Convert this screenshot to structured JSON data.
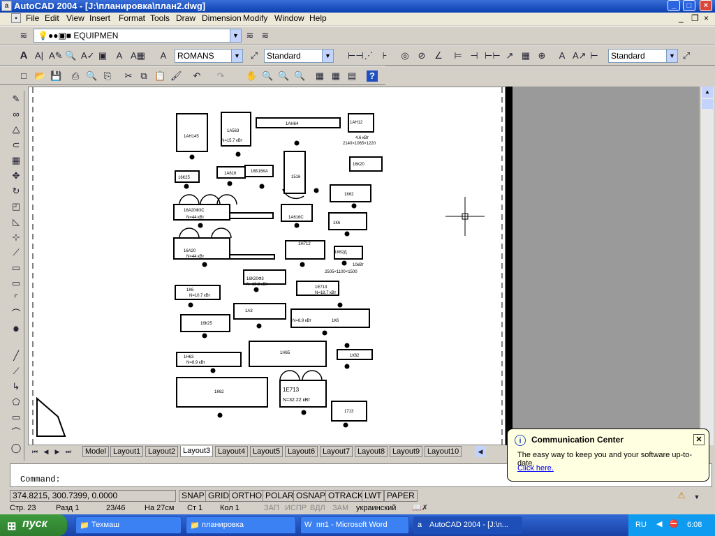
{
  "window": {
    "title": "AutoCAD 2004 - [J:\\планировка\\план2.dwg]"
  },
  "menu": [
    "File",
    "Edit",
    "View",
    "Insert",
    "Format",
    "Tools",
    "Draw",
    "Dimension",
    "Modify",
    "Window",
    "Help"
  ],
  "layer_combo": {
    "value": "EQUIPMEN"
  },
  "text_style": {
    "value": "ROMANS"
  },
  "dim_style": {
    "value": "Standard"
  },
  "table_style": {
    "value": "Standard"
  },
  "drawing_labels": [
    "1АН145",
    "1А563",
    "1АН64",
    "1АН12",
    "1А616",
    "16Б16",
    "1516",
    "16К20",
    "1К62",
    "16А20Ф3С",
    "1А616С",
    "1К62б",
    "16А20",
    "1Н712",
    "1Н713",
    "1А3",
    "16К25",
    "1Н65",
    "1Е713",
    "1713",
    "1А916",
    "16К20Ф3",
    "16Б16КА",
    "1К6",
    "1Е713",
    "1К62Д",
    "1Н63",
    "1К62",
    "1К62"
  ],
  "drawing_power": {
    "p1": "N=15.7 кВт",
    "p2": "N=44 кВт",
    "p3": "N=44 кВт",
    "p4": "N=10.8 кВт",
    "p5": "N=8.9 кВт",
    "p6": "N=32.22 кВт",
    "p7": "N=18.7 кВт",
    "p8": "N=10.7 кВт",
    "p9": "N=8.9 кВт",
    "p10": "N=32.22 кВт",
    "p11": "10кВт",
    "p12": "2505×1100×1500",
    "p13": "4.6 кВт",
    "p14": "2140×1065×1220"
  },
  "tabs": [
    "Model",
    "Layout1",
    "Layout2",
    "Layout3",
    "Layout4",
    "Layout5",
    "Layout6",
    "Layout7",
    "Layout8",
    "Layout9",
    "Layout10"
  ],
  "command": {
    "prompt": "Command:"
  },
  "status": {
    "coords": "374.8215, 300.7399, 0.0000",
    "buttons": [
      "SNAP",
      "GRID",
      "ORTHO",
      "POLAR",
      "OSNAP",
      "OTRACK",
      "LWT",
      "PAPER"
    ]
  },
  "word_status": {
    "page": "Стр. 23",
    "section": "Разд 1",
    "pages": "23/46",
    "at": "На 27см",
    "line": "Ст 1",
    "col": "Кол 1",
    "flags": [
      "ЗАП",
      "ИСПР",
      "ВДЛ",
      "ЗАМ"
    ],
    "lang": "украинский"
  },
  "balloon": {
    "title": "Communication Center",
    "text": "The easy way to keep you and your software up-to-date.",
    "link": "Click here."
  },
  "taskbar": {
    "start": "пуск",
    "tasks": [
      "Техмаш",
      "планировка",
      "пп1 - Microsoft Word",
      "AutoCAD 2004 - [J:\\п..."
    ],
    "lang": "RU",
    "time": "6:08"
  },
  "colors": {
    "titlebar": "#0a3fb0",
    "taskbar": "#245edb",
    "start": "#3c9a3c",
    "tray": "#0f9cf0"
  }
}
